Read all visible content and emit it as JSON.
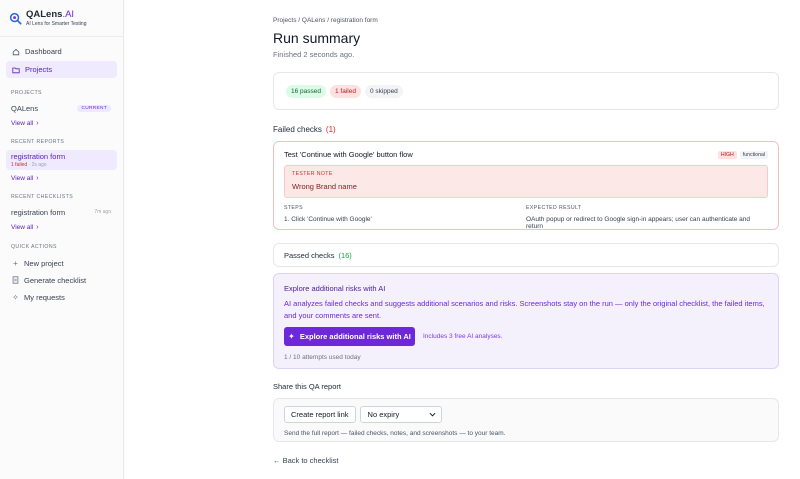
{
  "brand": {
    "name": "QALens",
    "name_suffix": ".AI",
    "tagline": "AI Lens for Smarter Testing",
    "accent": "#6d28d9"
  },
  "nav": [
    {
      "label": "Dashboard",
      "icon": "home-icon"
    },
    {
      "label": "Projects",
      "icon": "folder-icon",
      "active": true
    }
  ],
  "sidebar": {
    "projects_label": "PROJECTS",
    "project": {
      "name": "QALens",
      "badge": "CURRENT"
    },
    "projects_view_all": "View all",
    "reports_label": "RECENT REPORTS",
    "report": {
      "title": "registration form",
      "failed": "1 failed",
      "ago": " · 2s ago"
    },
    "reports_view_all": "View all",
    "checklists_label": "RECENT CHECKLISTS",
    "checklist": {
      "title": "registration form",
      "ago": "7m ago"
    },
    "checklists_view_all": "View all",
    "quick_label": "QUICK ACTIONS",
    "quick": [
      {
        "label": "New project",
        "icon": "plus-icon"
      },
      {
        "label": "Generate checklist",
        "icon": "document-icon"
      },
      {
        "label": "My requests",
        "icon": "sparkle-icon"
      }
    ]
  },
  "main": {
    "breadcrumb": "Projects / QALens / registration form",
    "title": "Run summary",
    "subtitle": "Finished 2 seconds ago.",
    "summary": {
      "passed": "16 passed",
      "failed": "1 failed",
      "skipped": "0 skipped"
    },
    "failed_header": "Failed checks",
    "failed_count": "(1)",
    "failed_check": {
      "title": "Test 'Continue with Google' button flow",
      "severity": "HIGH",
      "type": "functional",
      "note_label": "TESTER NOTE",
      "note": "Wrong Brand name",
      "steps_label": "STEPS",
      "step": "1. Click 'Continue with Google'",
      "expected_label": "EXPECTED RESULT",
      "expected": "OAuth popup or redirect to Google sign-in appears; user can authenticate and return"
    },
    "passed_header": "Passed checks",
    "passed_count": "(16)",
    "ai": {
      "title": "Explore additional risks with AI",
      "description": "AI analyzes failed checks and suggests additional scenarios and risks. Screenshots stay on the run — only the original checklist, the failed items, and your comments are sent.",
      "button": "Explore additional risks with AI",
      "includes": "Includes 3 free AI analyses.",
      "attempts": "1 / 10 attempts used today"
    },
    "share": {
      "header": "Share this QA report",
      "create_button": "Create report link",
      "expiry": "No expiry",
      "hint": "Send the full report — failed checks, notes, and screenshots — to your team."
    },
    "back": "← Back to checklist"
  }
}
